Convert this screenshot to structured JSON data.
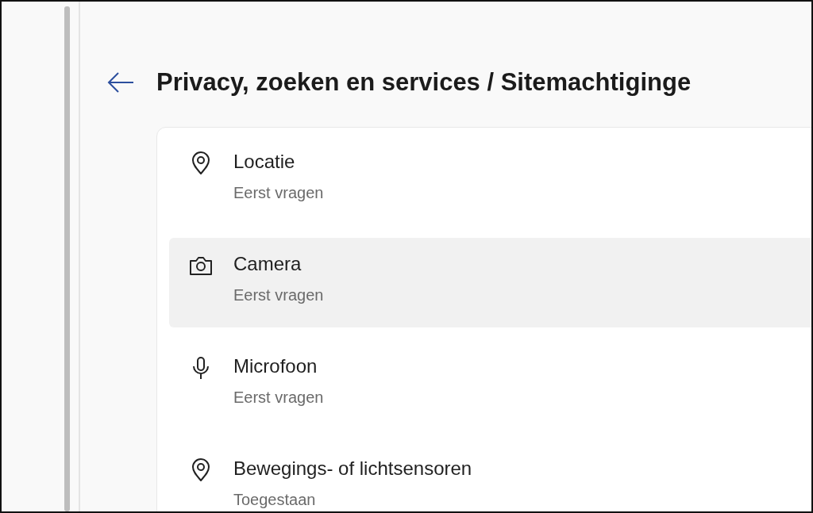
{
  "header": {
    "title": "Privacy, zoeken en services / Sitemachtiginge"
  },
  "permissions": [
    {
      "kind": "location",
      "title": "Locatie",
      "value": "Eerst vragen",
      "selected": false
    },
    {
      "kind": "camera",
      "title": "Camera",
      "value": "Eerst vragen",
      "selected": true
    },
    {
      "kind": "microphone",
      "title": "Microfoon",
      "value": "Eerst vragen",
      "selected": false
    },
    {
      "kind": "location",
      "title": "Bewegings- of lichtsensoren",
      "value": "Toegestaan",
      "selected": false
    }
  ]
}
